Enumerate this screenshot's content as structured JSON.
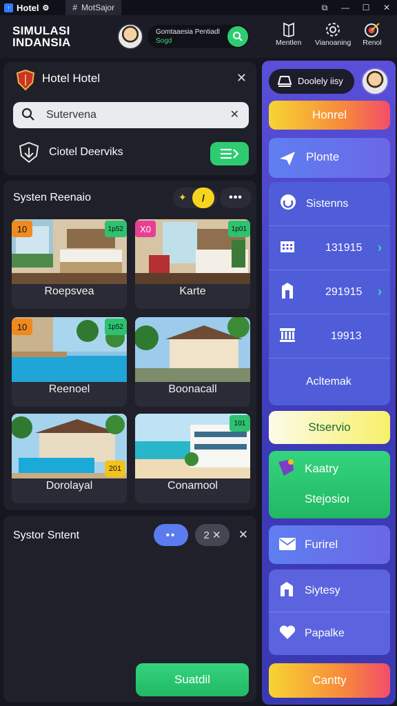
{
  "titlebar": {
    "app_name": "Hotel",
    "tab_label": "MotSajor",
    "controls": [
      "⧉",
      "—",
      "☐",
      "✕"
    ]
  },
  "appbar": {
    "brand_line1": "SIMULASI",
    "brand_line2": "INDANSIA",
    "user_name": "Gomtaaesia Pentiadl",
    "user_status": "Sogd",
    "nav": [
      {
        "label": "Mentlen",
        "icon": "book-icon"
      },
      {
        "label": "Vianoaning",
        "icon": "gear-icon"
      },
      {
        "label": "Renol",
        "icon": "target-icon"
      }
    ]
  },
  "hotel_panel": {
    "title": "Hotel Hotel",
    "search_value": "Sutervena",
    "deerviks_label": "Ciotel Deerviks"
  },
  "system_panel": {
    "title": "Systen Reenaio",
    "cards": [
      {
        "label": "Roepsvea",
        "badge_left": "10",
        "badge_right": "1p52"
      },
      {
        "label": "Karte",
        "badge_left": "X0",
        "badge_right": "1p01"
      },
      {
        "label": "Reenoel",
        "badge_left": "10",
        "badge_right": "1p52"
      },
      {
        "label": "Boonacall",
        "badge_left": "",
        "badge_right": ""
      },
      {
        "label": "Dorolayal",
        "badge_left": "",
        "badge_right": "201"
      },
      {
        "label": "Conamool",
        "badge_left": "",
        "badge_right": "101"
      }
    ]
  },
  "status_panel": {
    "title": "Systor Sntent",
    "pill_dots": "••",
    "pill_count": "2 ✕",
    "submit_label": "Suatdil"
  },
  "sidebar": {
    "top_label": "Doolely iisy",
    "honrel": "Honrel",
    "plonte": "Plonte",
    "sistenns": "Sistenns",
    "rows": [
      "131915",
      "291915",
      "19913"
    ],
    "acltemak": "Acltemak",
    "stservio": "Stservio",
    "kaatry": "Kaatry",
    "stejosioi": "Stejosioı",
    "furirel": "Furirel",
    "siytesy": "Siytesy",
    "papalke": "Papalke",
    "cantty": "Cantty"
  },
  "colors": {
    "accent_green": "#2ecc71",
    "accent_yellow": "#f6d51d",
    "sidebar_purple": "#5a4fd8"
  }
}
